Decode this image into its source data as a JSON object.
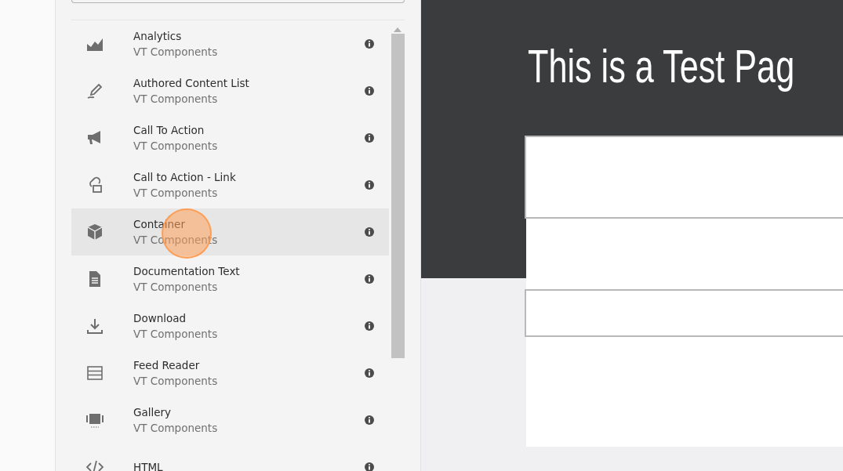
{
  "components": [
    {
      "title": "Analytics",
      "subtitle": "VT Components",
      "kind": "chart",
      "selected": false
    },
    {
      "title": "Authored Content List",
      "subtitle": "VT Components",
      "kind": "pen",
      "selected": false
    },
    {
      "title": "Call To Action",
      "subtitle": "VT Components",
      "kind": "megaphone",
      "selected": false
    },
    {
      "title": "Call to Action - Link",
      "subtitle": "VT Components",
      "kind": "link",
      "selected": false
    },
    {
      "title": "Container",
      "subtitle": "VT Components",
      "kind": "box",
      "selected": true
    },
    {
      "title": "Documentation Text",
      "subtitle": "VT Components",
      "kind": "document",
      "selected": false
    },
    {
      "title": "Download",
      "subtitle": "VT Components",
      "kind": "download",
      "selected": false
    },
    {
      "title": "Feed Reader",
      "subtitle": "VT Components",
      "kind": "rows",
      "selected": false
    },
    {
      "title": "Gallery",
      "subtitle": "VT Components",
      "kind": "gallery",
      "selected": false
    },
    {
      "title": "HTML",
      "kind": "code",
      "selected": false
    }
  ],
  "page": {
    "heading": "This is a Test Pag"
  }
}
